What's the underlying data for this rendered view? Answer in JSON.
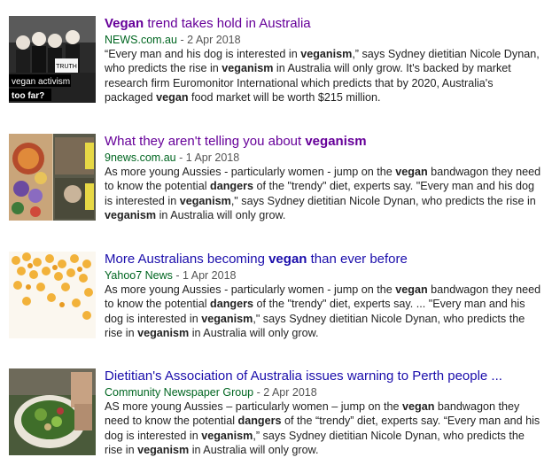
{
  "colors": {
    "link": "#1a0dab",
    "visited": "#660099",
    "source": "#006621",
    "meta": "#545454",
    "text": "#222222"
  },
  "results": [
    {
      "title_parts": [
        {
          "t": "Vegan",
          "b": true
        },
        {
          "t": " trend takes hold in Australia",
          "b": false
        }
      ],
      "source": "NEWS.com.au",
      "date": "2 Apr 2018",
      "thumb_caption_1": "vegan activism",
      "thumb_caption_2": "too far?",
      "thumb_sign_1": "TRUTH",
      "snippet_parts": [
        {
          "t": "“Every man and his dog is interested in ",
          "b": false
        },
        {
          "t": "veganism",
          "b": true
        },
        {
          "t": ",” says Sydney dietitian Nicole Dynan, who predicts the rise in ",
          "b": false
        },
        {
          "t": "veganism",
          "b": true
        },
        {
          "t": " in Australia will only grow. It's backed by market research firm Euromonitor International which predicts that by 2020, Australia's packaged ",
          "b": false
        },
        {
          "t": "vegan",
          "b": true
        },
        {
          "t": " food market will be worth $215 million.",
          "b": false
        }
      ]
    },
    {
      "title_parts": [
        {
          "t": "What they aren't telling you about ",
          "b": false
        },
        {
          "t": "veganism",
          "b": true
        }
      ],
      "source": "9news.com.au",
      "date": "1 Apr 2018",
      "snippet_parts": [
        {
          "t": "As more young Aussies - particularly women - jump on the ",
          "b": false
        },
        {
          "t": "vegan",
          "b": true
        },
        {
          "t": " bandwagon they need to know the potential ",
          "b": false
        },
        {
          "t": "dangers",
          "b": true
        },
        {
          "t": " of the \"trendy\" diet, experts say. \"Every man and his dog is interested in ",
          "b": false
        },
        {
          "t": "veganism",
          "b": true
        },
        {
          "t": ",\" says Sydney dietitian Nicole Dynan, who predicts the rise in ",
          "b": false
        },
        {
          "t": "veganism",
          "b": true
        },
        {
          "t": " in Australia will only grow.",
          "b": false
        }
      ]
    },
    {
      "title_parts": [
        {
          "t": "More Australians becoming ",
          "b": false
        },
        {
          "t": "vegan",
          "b": true
        },
        {
          "t": " than ever before",
          "b": false
        }
      ],
      "source": "Yahoo7 News",
      "date": "1 Apr 2018",
      "snippet_parts": [
        {
          "t": "As more young Aussies - particularly women - jump on the ",
          "b": false
        },
        {
          "t": "vegan",
          "b": true
        },
        {
          "t": " bandwagon they need to know the potential ",
          "b": false
        },
        {
          "t": "dangers",
          "b": true
        },
        {
          "t": " of the \"trendy\" diet, experts say. ... \"Every man and his dog is interested in ",
          "b": false
        },
        {
          "t": "veganism",
          "b": true
        },
        {
          "t": ",\" says Sydney dietitian Nicole Dynan, who predicts the rise in ",
          "b": false
        },
        {
          "t": "veganism",
          "b": true
        },
        {
          "t": " in Australia will only grow.",
          "b": false
        }
      ]
    },
    {
      "title_parts": [
        {
          "t": "Dietitian's Association of Australia issues warning to Perth people ...",
          "b": false
        }
      ],
      "source": "Community Newspaper Group",
      "date": "2 Apr 2018",
      "snippet_parts": [
        {
          "t": "AS more young Aussies – particularly women – jump on the ",
          "b": false
        },
        {
          "t": "vegan",
          "b": true
        },
        {
          "t": " bandwagon they need to know the potential ",
          "b": false
        },
        {
          "t": "dangers",
          "b": true
        },
        {
          "t": " of the “trendy” diet, experts say. “Every man and his dog is interested in ",
          "b": false
        },
        {
          "t": "veganism",
          "b": true
        },
        {
          "t": ",” says Sydney dietitian Nicole Dynan, who predicts the rise in ",
          "b": false
        },
        {
          "t": "veganism",
          "b": true
        },
        {
          "t": " in Australia will only grow.",
          "b": false
        }
      ]
    }
  ],
  "separator": " - "
}
